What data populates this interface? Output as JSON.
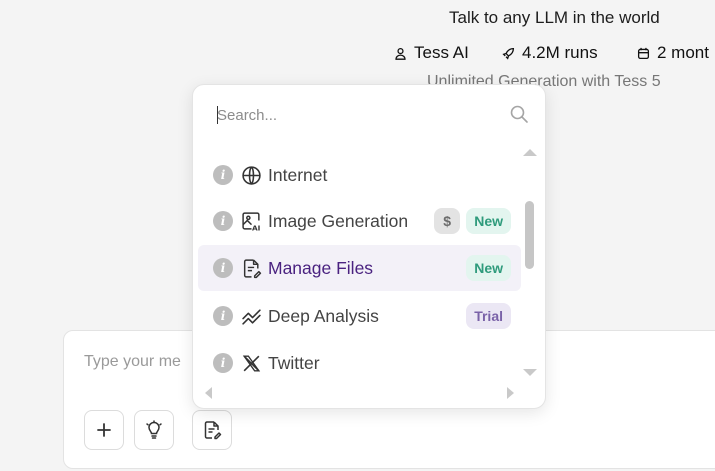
{
  "header": {
    "title": "Talk to any LLM in the world",
    "author": "Tess AI",
    "runs": "4.2M runs",
    "age": "2 mont",
    "subtitle": "Unlimited Generation with Tess 5"
  },
  "chat": {
    "placeholder": "Type your me",
    "buttons": [
      "plus-icon",
      "lightbulb-icon",
      "file-edit-icon"
    ]
  },
  "dropdown": {
    "search_placeholder": "Search...",
    "items": [
      {
        "label": "Internet",
        "icon": "globe-icon",
        "badges": []
      },
      {
        "label": "Image Generation",
        "icon": "image-ai-icon",
        "badges": [
          "$",
          "New"
        ]
      },
      {
        "label": "Manage Files",
        "icon": "file-edit-icon",
        "badges": [
          "New"
        ],
        "selected": true
      },
      {
        "label": "Deep Analysis",
        "icon": "chart-line-icon",
        "badges": [
          "Trial"
        ]
      },
      {
        "label": "Twitter",
        "icon": "x-logo-icon",
        "badges": []
      }
    ]
  },
  "colors": {
    "selected_bg": "#f3f1f8",
    "selected_text": "#4a2280",
    "new_badge": "#2f9b7c",
    "trial_badge": "#7a62a8"
  }
}
